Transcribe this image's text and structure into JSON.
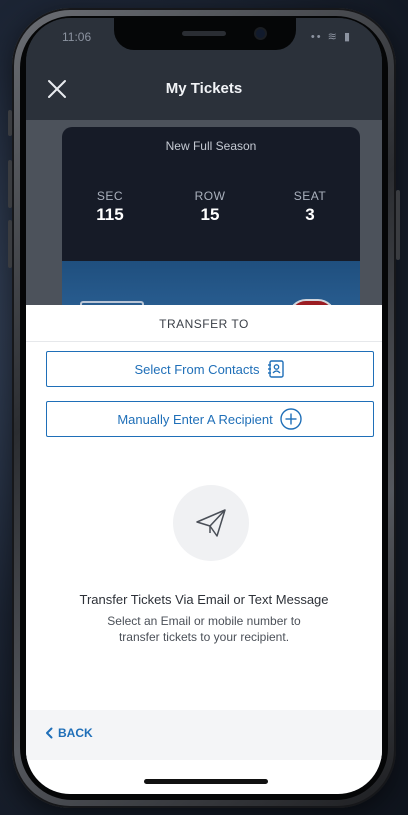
{
  "status_bar": {
    "time": "11:06",
    "icons": "••  ≋ ▮"
  },
  "header": {
    "title": "My Tickets",
    "close_icon": "close-icon"
  },
  "ticket": {
    "name": "New Full Season",
    "section": {
      "label": "SEC",
      "value": "115"
    },
    "row": {
      "label": "ROW",
      "value": "15"
    },
    "seat": {
      "label": "SEAT",
      "value": "3"
    }
  },
  "sheet": {
    "title": "TRANSFER TO",
    "select_contacts_label": "Select From Contacts",
    "manual_entry_label": "Manually Enter A Recipient",
    "empty_title": "Transfer Tickets Via Email or Text Message",
    "empty_desc": "Select an Email or mobile number to transfer tickets to your recipient.",
    "back_label": "BACK"
  },
  "colors": {
    "accent": "#1f6fb8",
    "header_bg": "#2b313a",
    "ticket_bg": "#161b27"
  }
}
